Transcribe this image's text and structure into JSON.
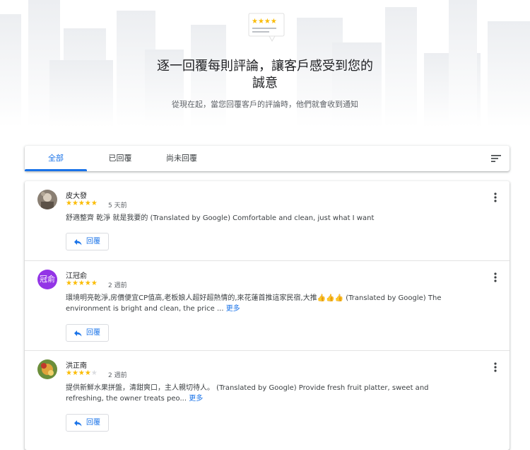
{
  "hero": {
    "title_line1": "逐一回覆每則評論，讓客戶感受到您的",
    "title_line2": "誠意",
    "subtitle": "從現在起，當您回覆客戶的評論時，他們就會收到通知"
  },
  "tabs": [
    {
      "label": "全部",
      "active": true
    },
    {
      "label": "已回覆",
      "active": false
    },
    {
      "label": "尚未回覆",
      "active": false
    }
  ],
  "sort_icon": "sort-icon",
  "reviews": [
    {
      "name": "皮大發",
      "rating": 5,
      "time": "5 天前",
      "text": "舒適整齊 乾淨 就是我要的 (Translated by Google) Comfortable and clean, just what I want",
      "more": "",
      "reply_label": "回覆",
      "avatar": "photo"
    },
    {
      "name": "江冠俞",
      "rating": 5,
      "time": "2 週前",
      "text": "環境明亮乾淨,房價便宜CP值高,老板娘人超好超熱情的,來花蓮首推這家民宿,大推👍👍👍 (Translated by Google) The environment is bright and clean, the price ...",
      "more": "更多",
      "reply_label": "回覆",
      "avatar_initials": "冠俞"
    },
    {
      "name": "洪正南",
      "rating": 4,
      "time": "2 週前",
      "text": "提供新鮮水果拼盤，清甜爽口，主人親切待人。 (Translated by Google) Provide fresh fruit platter, sweet and refreshing, the owner treats peo...",
      "more": "更多",
      "reply_label": "回覆",
      "avatar": "photo"
    }
  ],
  "colors": {
    "accent": "#1a73e8",
    "star": "#fbbc04",
    "star_empty": "#dadce0",
    "avatar_purple": "#9334e6"
  }
}
